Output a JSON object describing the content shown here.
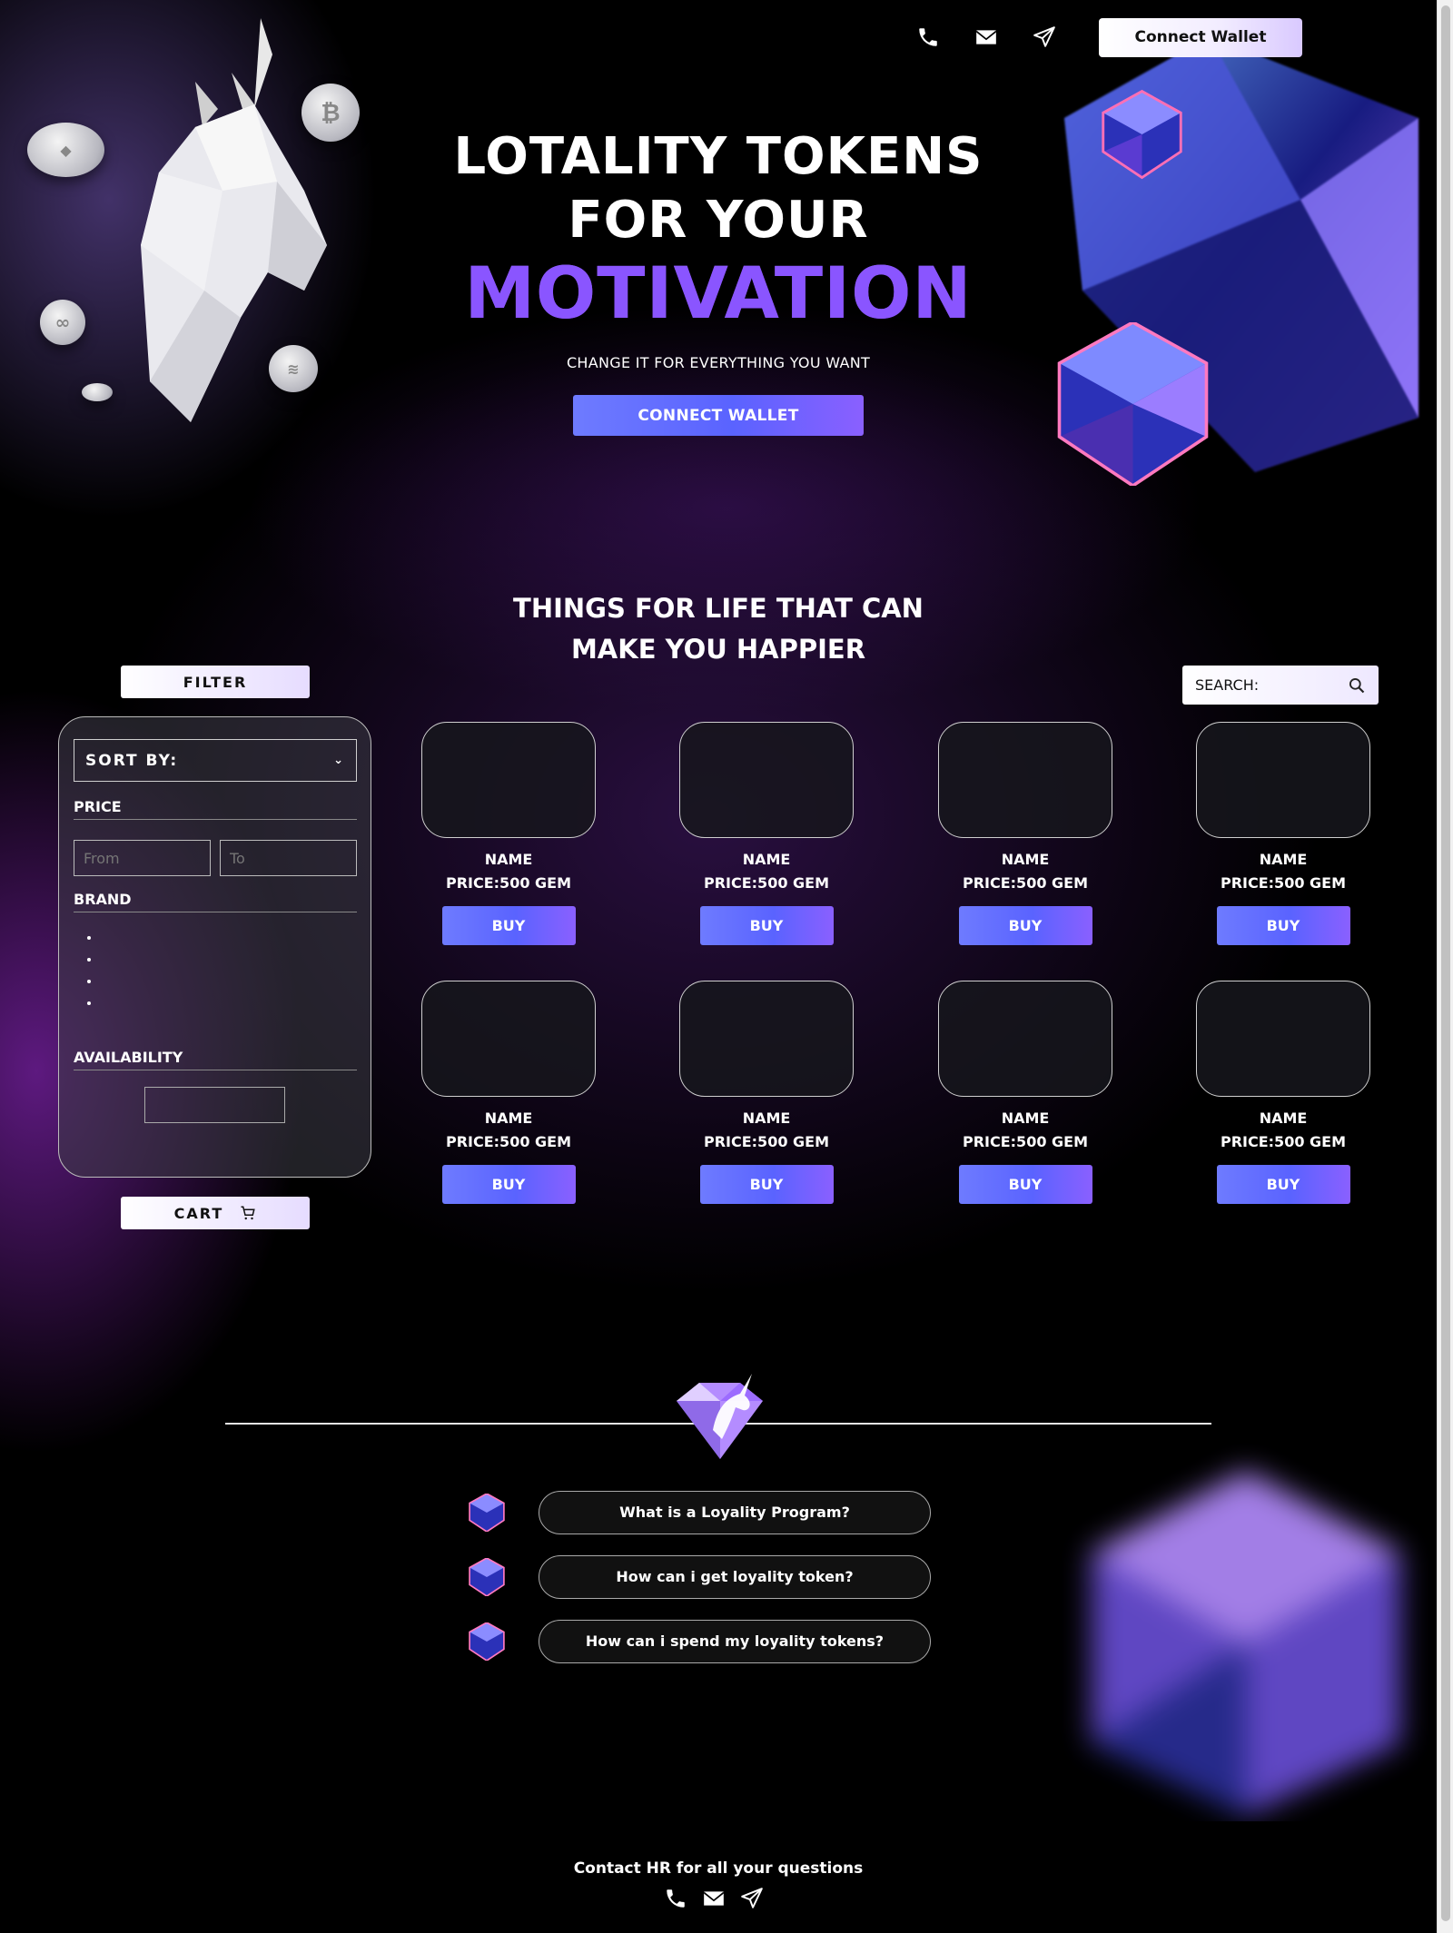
{
  "header": {
    "connect_wallet_label": "Connect Wallet",
    "icons": [
      "phone-icon",
      "mail-icon",
      "send-icon"
    ]
  },
  "hero": {
    "title_line1": "LOTALITY TOKENS",
    "title_line2": "FOR YOUR",
    "title_accent": "MOTIVATION",
    "subtitle": "CHANGE IT FOR EVERYTHING YOU WANT",
    "connect_label": "CONNECT WALLET"
  },
  "shop": {
    "title_line1": "THINGS FOR LIFE THAT CAN",
    "title_line2": "MAKE YOU HAPPIER",
    "filter_label": "FILTER",
    "search_label": "SEARCH:",
    "sort_label": "SORT BY:",
    "price_label": "PRICE",
    "price_from_placeholder": "From",
    "price_to_placeholder": "To",
    "brand_label": "BRAND",
    "availability_label": "AVAILABILITY",
    "cart_label": "CART",
    "products": [
      {
        "name": "NAME",
        "price": "PRICE:500 GEM",
        "buy": "BUY"
      },
      {
        "name": "NAME",
        "price": "PRICE:500 GEM",
        "buy": "BUY"
      },
      {
        "name": "NAME",
        "price": "PRICE:500 GEM",
        "buy": "BUY"
      },
      {
        "name": "NAME",
        "price": "PRICE:500 GEM",
        "buy": "BUY"
      },
      {
        "name": "NAME",
        "price": "PRICE:500 GEM",
        "buy": "BUY"
      },
      {
        "name": "NAME",
        "price": "PRICE:500 GEM",
        "buy": "BUY"
      },
      {
        "name": "NAME",
        "price": "PRICE:500 GEM",
        "buy": "BUY"
      },
      {
        "name": "NAME",
        "price": "PRICE:500 GEM",
        "buy": "BUY"
      }
    ]
  },
  "faq": {
    "items": [
      "What is a Loyality Program?",
      "How can i get loyality token?",
      "How can i spend my loyality tokens?"
    ]
  },
  "footer": {
    "text": "Contact HR for all your questions"
  },
  "colors": {
    "accent": "#8a55ff",
    "button_blue": "#5a63ff",
    "background": "#000000"
  }
}
